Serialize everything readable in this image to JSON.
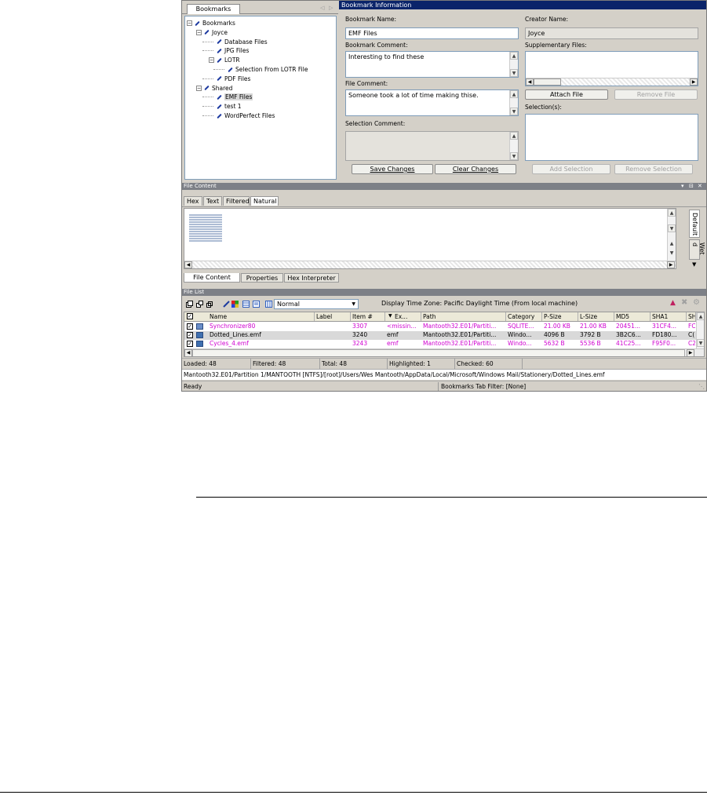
{
  "bookmarks_panel": {
    "tab_label": "Bookmarks",
    "tree": [
      {
        "label": "Bookmarks",
        "level": 0,
        "expander": "-"
      },
      {
        "label": "Joyce",
        "level": 1,
        "expander": "-"
      },
      {
        "label": "Database Files",
        "level": 2,
        "expander": ""
      },
      {
        "label": "JPG Files",
        "level": 2,
        "expander": ""
      },
      {
        "label": "LOTR",
        "level": 2,
        "expander": "-"
      },
      {
        "label": "Selection From LOTR File",
        "level": 3,
        "expander": ""
      },
      {
        "label": "PDF Files",
        "level": 2,
        "expander": ""
      },
      {
        "label": "Shared",
        "level": 1,
        "expander": "-"
      },
      {
        "label": "EMF Files",
        "level": 2,
        "expander": "",
        "selected": true
      },
      {
        "label": "test 1",
        "level": 2,
        "expander": ""
      },
      {
        "label": "WordPerfect Files",
        "level": 2,
        "expander": ""
      }
    ]
  },
  "bookmark_info": {
    "title": "Bookmark Information",
    "bookmark_name_label": "Bookmark Name:",
    "bookmark_name_value": "EMF Files",
    "creator_name_label": "Creator Name:",
    "creator_name_value": "Joyce",
    "bookmark_comment_label": "Bookmark Comment:",
    "bookmark_comment_value": "Interesting to find these",
    "supplementary_files_label": "Supplementary Files:",
    "file_comment_label": "File Comment:",
    "file_comment_value": "Someone took a lot of time making thise.",
    "attach_file": "Attach File",
    "remove_file": "Remove File",
    "selections_label": "Selection(s):",
    "selection_comment_label": "Selection Comment:",
    "save_changes": "Save Changes",
    "clear_changes": "Clear Changes",
    "add_selection": "Add Selection",
    "remove_selection": "Remove Selection"
  },
  "file_content": {
    "title": "File Content",
    "view_tabs": [
      "Hex",
      "Text",
      "Filtered",
      "Natural"
    ],
    "active_view_tab": "Natural",
    "side_tabs": [
      "Default",
      "Wet d"
    ],
    "bottom_tabs": [
      "File Content",
      "Properties",
      "Hex Interpreter"
    ]
  },
  "file_list": {
    "title": "File List",
    "view_mode": "Normal",
    "timezone": "Display Time Zone: Pacific Daylight Time  (From local machine)",
    "columns": [
      "Name",
      "Label",
      "Item #",
      "Ex...",
      "Path",
      "Category",
      "P-Size",
      "L-Size",
      "MD5",
      "SHA1",
      "SH"
    ],
    "rows": [
      {
        "checked": true,
        "name": "Synchronizer80",
        "label": "",
        "item": "3307",
        "ext": "<missin...",
        "path": "Mantooth32.E01/Partiti...",
        "category": "SQLITE...",
        "psize": "21.00 KB",
        "lsize": "21.00 KB",
        "md5": "20451...",
        "sha1": "31CF4...",
        "sh": "FC",
        "color": "#d000d0"
      },
      {
        "checked": true,
        "name": "Dotted_Lines.emf",
        "label": "",
        "item": "3240",
        "ext": "emf",
        "path": "Mantooth32.E01/Partiti...",
        "category": "Windo...",
        "psize": "4096 B",
        "lsize": "3792 B",
        "md5": "3B2C6...",
        "sha1": "FD180...",
        "sh": "C(",
        "color": "#000000"
      },
      {
        "checked": true,
        "name": "Cycles_4.emf",
        "label": "",
        "item": "3243",
        "ext": "emf",
        "path": "Mantooth32.E01/Partiti...",
        "category": "Windo...",
        "psize": "5632 B",
        "lsize": "5536 B",
        "md5": "41C25...",
        "sha1": "F95F0...",
        "sh": "C2",
        "color": "#d000d0"
      }
    ],
    "stats": {
      "loaded": "Loaded: 48",
      "filtered": "Filtered: 48",
      "total": "Total: 48",
      "highlighted": "Highlighted: 1",
      "checked": "Checked: 60"
    }
  },
  "status_bar": {
    "path": "Mantooth32.E01/Partition 1/MANTOOTH [NTFS]/[root]/Users/Wes Mantooth/AppData/Local/Microsoft/Windows Mail/Stationery/Dotted_Lines.emf",
    "ready": "Ready",
    "bookmarks_filter": "Bookmarks Tab Filter: [None]"
  },
  "colors": {
    "title_blue": "#0a246a",
    "panel_gray": "#7d8087",
    "magenta": "#d000d0",
    "selection_blue": "#3169c6"
  }
}
